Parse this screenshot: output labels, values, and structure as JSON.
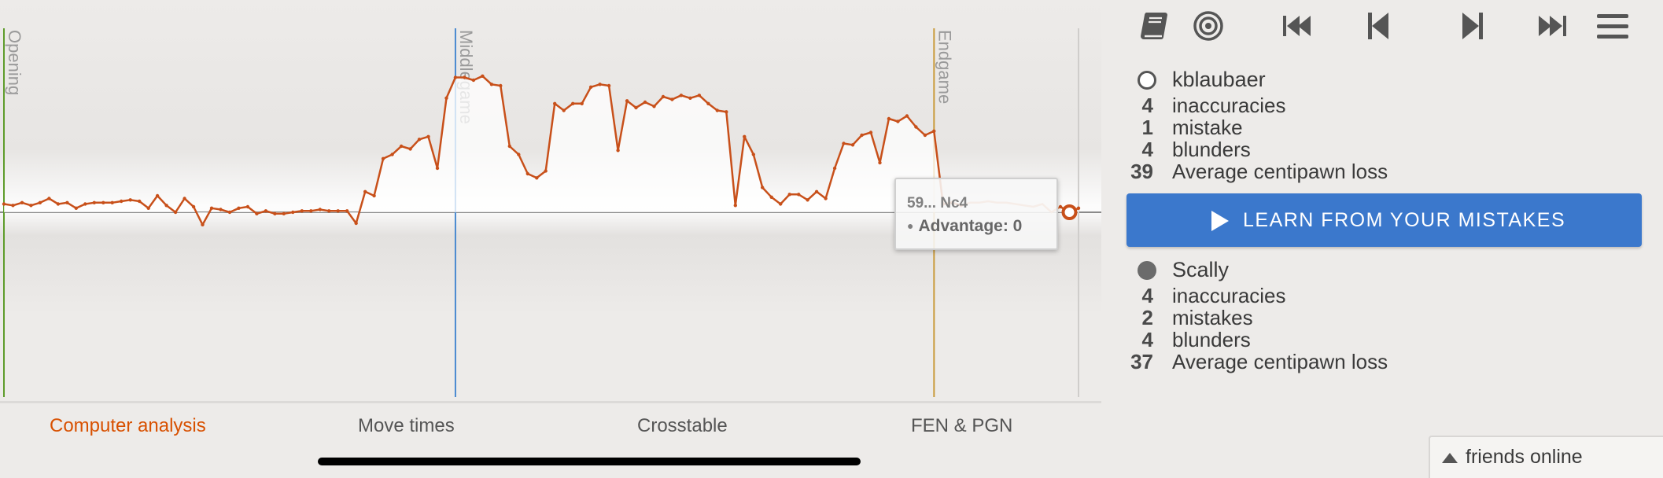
{
  "chart": {
    "phases": [
      {
        "label": "Opening",
        "color": "#5e9c2a"
      },
      {
        "label": "Middlegame",
        "color": "#4a8ad0"
      },
      {
        "label": "Endgame",
        "color": "#c99a3a"
      }
    ],
    "line_color": "#c8501a",
    "tooltip": {
      "move": "59... Nc4",
      "advantage": "Advantage: 0"
    }
  },
  "chart_data": {
    "type": "area",
    "title": "",
    "xlabel": "",
    "ylabel": "Advantage",
    "ylim": [
      -1,
      1
    ],
    "phase_boundaries_ply": [
      1,
      51,
      104
    ],
    "series": [
      {
        "values": [
          0.06,
          0.05,
          0.07,
          0.05,
          0.07,
          0.1,
          0.06,
          0.07,
          0.03,
          0.06,
          0.07,
          0.07,
          0.07,
          0.08,
          0.09,
          0.08,
          0.03,
          0.12,
          0.05,
          0.0,
          0.1,
          0.04,
          -0.09,
          0.03,
          0.02,
          0.0,
          0.03,
          0.04,
          -0.01,
          0.01,
          -0.01,
          -0.01,
          0.0,
          0.01,
          0.01,
          0.02,
          0.01,
          0.01,
          0.01,
          -0.08,
          0.15,
          0.12,
          0.39,
          0.42,
          0.48,
          0.46,
          0.53,
          0.55,
          0.32,
          0.83,
          0.98,
          0.98,
          0.96,
          0.99,
          0.93,
          0.92,
          0.48,
          0.42,
          0.28,
          0.25,
          0.3,
          0.79,
          0.74,
          0.79,
          0.79,
          0.91,
          0.93,
          0.92,
          0.45,
          0.81,
          0.76,
          0.8,
          0.77,
          0.84,
          0.82,
          0.85,
          0.83,
          0.85,
          0.79,
          0.74,
          0.73,
          0.05,
          0.55,
          0.42,
          0.18,
          0.11,
          0.06,
          0.13,
          0.13,
          0.09,
          0.15,
          0.1,
          0.32,
          0.5,
          0.49,
          0.56,
          0.58,
          0.36,
          0.68,
          0.66,
          0.7,
          0.62,
          0.56,
          0.59,
          0.06,
          0.07,
          0.05,
          0.07,
          0.07,
          0.08,
          0.07,
          0.07,
          0.06,
          0.05,
          0.04,
          0.06,
          0.0,
          0.04,
          0.0,
          0.03
        ]
      }
    ]
  },
  "tabs": [
    {
      "label": "Computer analysis",
      "active": true
    },
    {
      "label": "Move times",
      "active": false
    },
    {
      "label": "Crosstable",
      "active": false
    },
    {
      "label": "FEN & PGN",
      "active": false
    }
  ],
  "controls": [
    {
      "icon": "book-icon"
    },
    {
      "icon": "target-icon"
    },
    {
      "icon": "first-move-icon"
    },
    {
      "icon": "previous-move-icon"
    },
    {
      "icon": "next-move-icon"
    },
    {
      "icon": "last-move-icon"
    },
    {
      "icon": "menu-icon"
    }
  ],
  "white_player": {
    "name": "kblaubaer",
    "stats": [
      {
        "num": "4",
        "label": "inaccuracies"
      },
      {
        "num": "1",
        "label": "mistake"
      },
      {
        "num": "4",
        "label": "blunders"
      },
      {
        "num": "39",
        "label": "Average centipawn loss"
      }
    ]
  },
  "learn_button": {
    "label": "LEARN FROM YOUR MISTAKES",
    "color": "#3b78cc"
  },
  "black_player": {
    "name": "Scally",
    "stats": [
      {
        "num": "4",
        "label": "inaccuracies"
      },
      {
        "num": "2",
        "label": "mistakes"
      },
      {
        "num": "4",
        "label": "blunders"
      },
      {
        "num": "37",
        "label": "Average centipawn loss"
      }
    ]
  },
  "friends": {
    "label": "friends online"
  }
}
